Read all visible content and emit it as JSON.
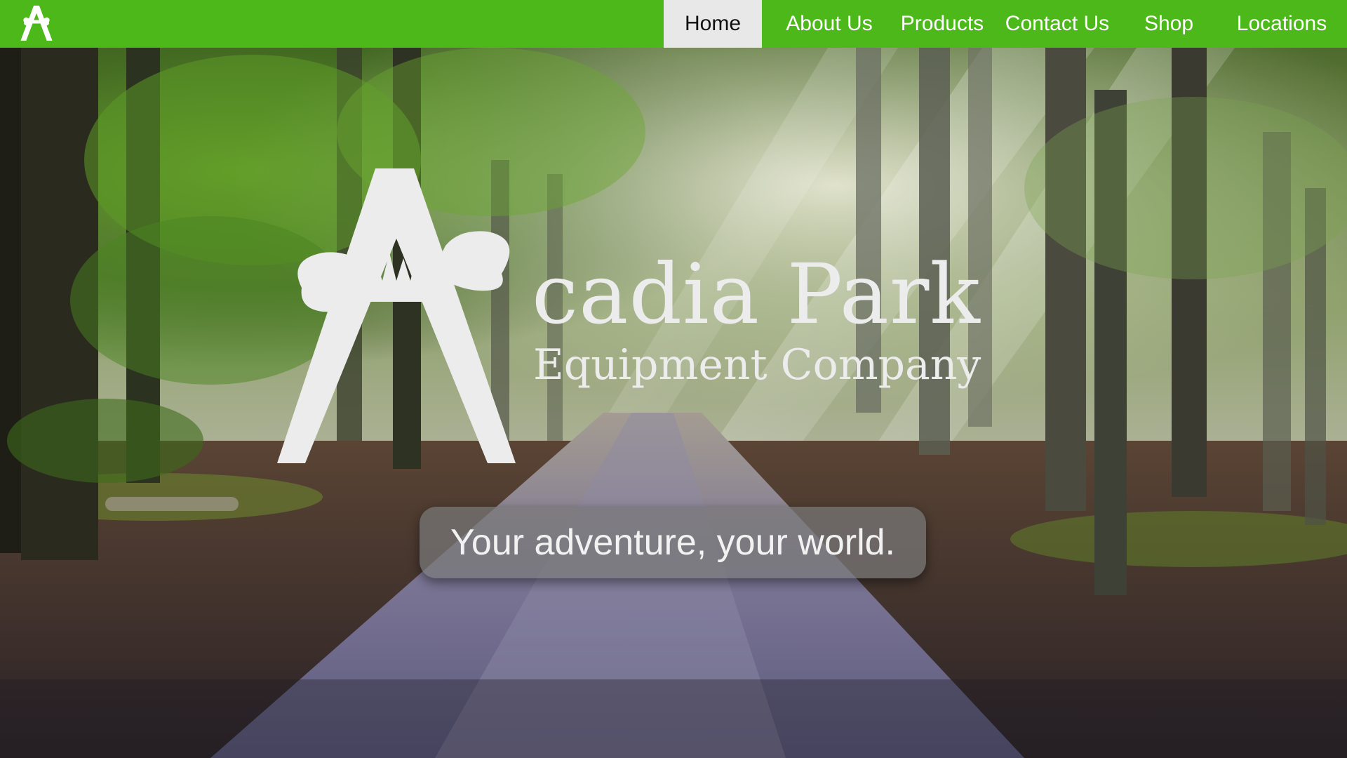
{
  "site": {
    "brand_name": "cadia Park",
    "brand_subtitle": "Equipment Company",
    "logo_letter_icon": "acadia-a-icon"
  },
  "nav": {
    "items": [
      {
        "label": "Home",
        "active": true
      },
      {
        "label": "About Us",
        "active": false
      },
      {
        "label": "Products",
        "active": false
      },
      {
        "label": "Contact Us",
        "active": false
      },
      {
        "label": "Shop",
        "active": false
      },
      {
        "label": "Locations",
        "active": false
      }
    ]
  },
  "hero": {
    "tagline": "Your adventure, your world.",
    "background": "forest-path-photo"
  },
  "colors": {
    "nav_bg": "#4cb81a",
    "nav_active_bg": "#e8e8e8",
    "nav_text": "#ffffff",
    "logo_color": "#ececec",
    "tagline_bg": "#787878"
  }
}
